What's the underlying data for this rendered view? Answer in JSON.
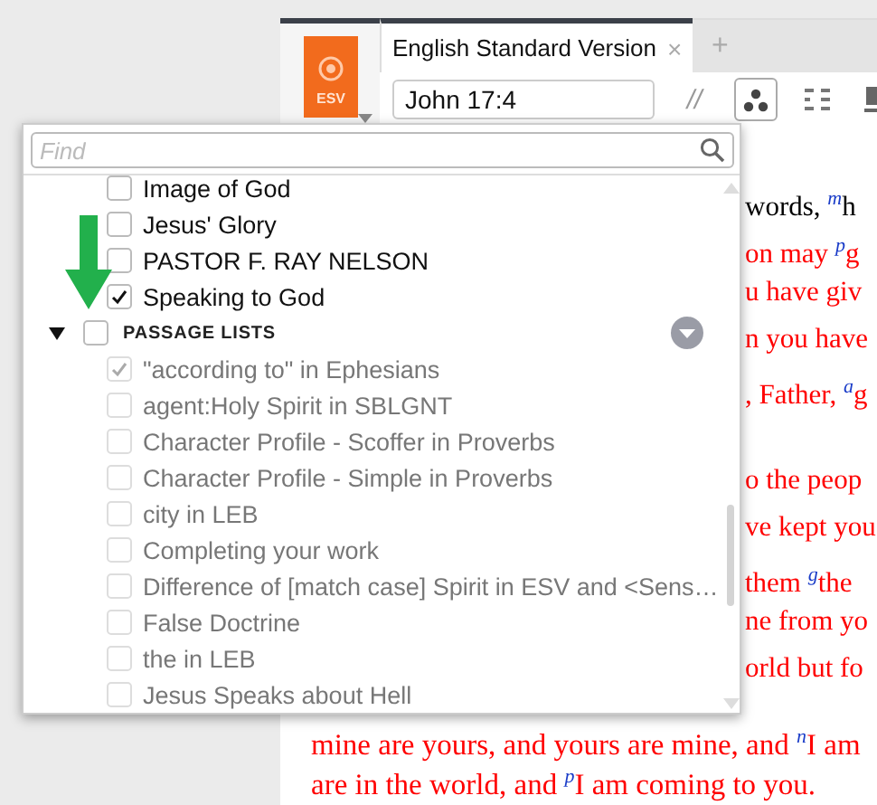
{
  "reader": {
    "icon_label": "ESV",
    "tab": {
      "title": "English Standard Version",
      "close": "×",
      "selected": true
    },
    "new_tab": "+",
    "reference": "John 17:4",
    "toolbar": [
      {
        "kind": "parallel",
        "label": "//",
        "selected": false
      },
      {
        "kind": "dots",
        "selected": true
      },
      {
        "kind": "grid",
        "selected": false
      },
      {
        "kind": "block",
        "selected": false
      }
    ],
    "side_paragraphs": [
      [
        {
          "text": "words, $^{m}$h",
          "red_letter": false
        },
        {
          "text": "on may $^{p}$g",
          "red_letter": true
        },
        {
          "text": "u have giv",
          "red_letter": true
        },
        {
          "text": "n you have",
          "red_letter": true
        },
        {
          "text": ", Father, $^{a}$g",
          "red_letter": true
        }
      ],
      [
        {
          "text": "o the peop",
          "red_letter": true
        },
        {
          "text": "ve kept you",
          "red_letter": true
        },
        {
          "text": "them $^{g}$the",
          "red_letter": true
        },
        {
          "text": "ne from yo",
          "red_letter": true
        },
        {
          "text": "orld but fo",
          "red_letter": true
        }
      ]
    ],
    "lines": [
      {
        "text": "mine are yours, and yours are mine, and $^{n}$I am",
        "red_letter": true
      },
      {
        "text": "are in the world, and $^{p}$I am coming to you.",
        "red_letter": true
      }
    ]
  },
  "panel": {
    "search": {
      "placeholder": "Find"
    },
    "items": [
      {
        "label": "Image of God",
        "checked": false
      },
      {
        "label": "Jesus' Glory",
        "checked": false
      },
      {
        "label": "PASTOR F. RAY NELSON",
        "checked": false
      },
      {
        "label": "Speaking to God",
        "checked": true
      }
    ],
    "groups": [
      {
        "title": "PASSAGE LISTS",
        "expanded": true,
        "checked": false,
        "children": [
          {
            "label": "\"according to\" in Ephesians",
            "checked": true,
            "disabled": true
          },
          {
            "label": "agent:Holy Spirit in SBLGNT",
            "checked": false,
            "disabled": true
          },
          {
            "label": "Character Profile - Scoffer in Proverbs",
            "checked": false,
            "disabled": true
          },
          {
            "label": "Character Profile - Simple in Proverbs",
            "checked": false,
            "disabled": true
          },
          {
            "label": "city in LEB",
            "checked": false,
            "disabled": true
          },
          {
            "label": "Completing your work",
            "checked": false,
            "disabled": true
          },
          {
            "label": "Difference of [match case] Spirit in ESV and <Sens…",
            "checked": false,
            "disabled": true
          },
          {
            "label": "False Doctrine",
            "checked": false,
            "disabled": true
          },
          {
            "label": "the in LEB",
            "checked": false,
            "disabled": true
          },
          {
            "label": "Jesus Speaks about Hell",
            "checked": false,
            "disabled": true
          }
        ]
      }
    ]
  }
}
